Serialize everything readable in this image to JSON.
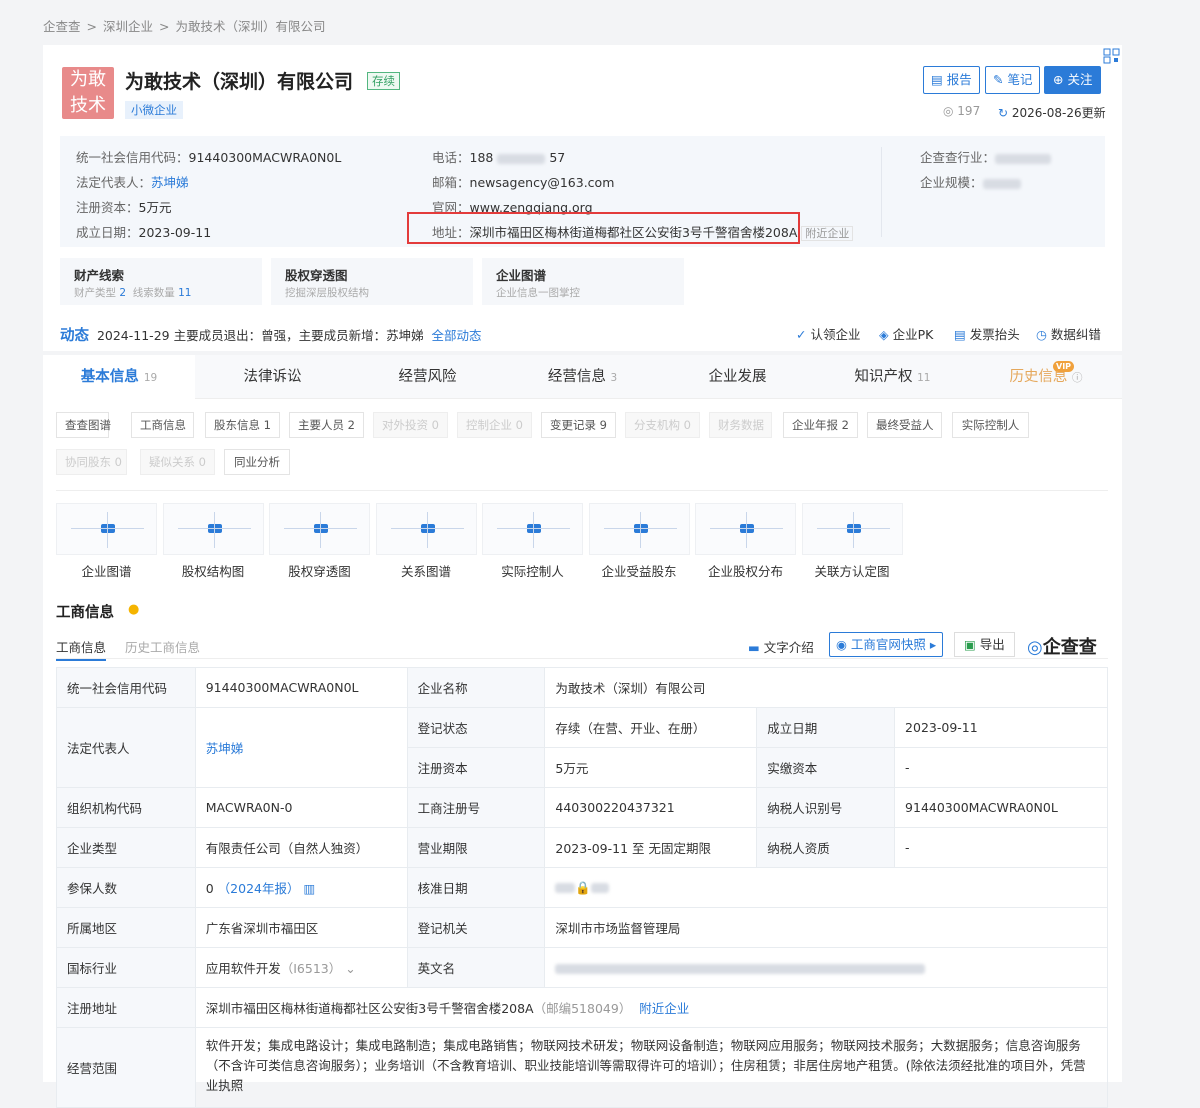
{
  "breadcrumb": {
    "home": "企查查",
    "sep": ">",
    "city": "深圳企业",
    "company": "为敢技术（深圳）有限公司"
  },
  "company": {
    "logo_text": "为敢技术",
    "name": "为敢技术（深圳）有限公司",
    "status": "存续",
    "size_tag": "小微企业"
  },
  "actions": {
    "report": "报告",
    "note": "笔记",
    "follow": "关注",
    "views": "197",
    "updated": "2026-08-26更新"
  },
  "info": {
    "credit_code_label": "统一社会信用代码：",
    "credit_code": "91440300MACWRA0N0L",
    "legal_label": "法定代表人：",
    "legal": "苏坤娣",
    "capital_label": "注册资本：",
    "capital": "5万元",
    "founded_label": "成立日期：",
    "founded": "2023-09-11",
    "phone_label": "电话：",
    "phone_a": "188",
    "phone_b": "57",
    "email_label": "邮箱：",
    "email": "newsagency@163.com",
    "web_label": "官网：",
    "web": "www.zengqiang.org",
    "addr_label": "地址：",
    "addr": "深圳市福田区梅林街道梅都社区公安街3号千警宿舍楼208A",
    "nearby": "附近企业",
    "industry_label": "企查查行业：",
    "scale_label": "企业规模："
  },
  "cards": [
    {
      "title": "财产线索",
      "sub1": "财产类型",
      "n1": "2",
      "sub2": "线索数量",
      "n2": "11"
    },
    {
      "title": "股权穿透图",
      "sub": "挖掘深层股权结构"
    },
    {
      "title": "企业图谱",
      "sub": "企业信息一图掌控"
    }
  ],
  "dynamic": {
    "title": "动态",
    "text": "2024-11-29 主要成员退出：曾强，主要成员新增：苏坤娣",
    "all": "全部动态"
  },
  "tools": [
    "认领企业",
    "企业PK",
    "发票抬头",
    "数据纠错"
  ],
  "tabs": [
    {
      "label": "基本信息",
      "count": "19"
    },
    {
      "label": "法律诉讼",
      "count": ""
    },
    {
      "label": "经营风险",
      "count": ""
    },
    {
      "label": "经营信息",
      "count": "3"
    },
    {
      "label": "企业发展",
      "count": ""
    },
    {
      "label": "知识产权",
      "count": "11"
    },
    {
      "label": "历史信息",
      "count": ""
    }
  ],
  "vip": "VIP",
  "chips": [
    "查查图谱",
    "工商信息",
    "股东信息 1",
    "主要人员 2",
    "对外投资 0",
    "控制企业 0",
    "变更记录 9",
    "分支机构 0",
    "财务数据",
    "企业年报 2",
    "最终受益人",
    "实际控制人",
    "协同股东 0",
    "疑似关系 0",
    "同业分析"
  ],
  "thumbs": [
    "企业图谱",
    "股权结构图",
    "股权穿透图",
    "关系图谱",
    "实际控制人",
    "企业受益股东",
    "企业股权分布",
    "关联方认定图"
  ],
  "section": {
    "title": "工商信息",
    "tab1": "工商信息",
    "tab2": "历史工商信息",
    "text_intro": "文字介绍",
    "snapshot": "工商官网快照",
    "export": "导出",
    "brand": "企查查"
  },
  "table": {
    "credit_code_k": "统一社会信用代码",
    "credit_code_v": "91440300MACWRA0N0L",
    "name_k": "企业名称",
    "name_v": "为敢技术（深圳）有限公司",
    "legal_k": "法定代表人",
    "legal_v": "苏坤娣",
    "reg_status_k": "登记状态",
    "reg_status_v": "存续（在营、开业、在册）",
    "found_k": "成立日期",
    "found_v": "2023-09-11",
    "capital_k": "注册资本",
    "capital_v": "5万元",
    "paid_k": "实缴资本",
    "paid_v": "-",
    "org_k": "组织机构代码",
    "org_v": "MACWRA0N-0",
    "regno_k": "工商注册号",
    "regno_v": "440300220437321",
    "tax_k": "纳税人识别号",
    "tax_v": "91440300MACWRA0N0L",
    "type_k": "企业类型",
    "type_v": "有限责任公司（自然人独资）",
    "term_k": "营业期限",
    "term_v": "2023-09-11 至 无固定期限",
    "taxq_k": "纳税人资质",
    "taxq_v": "-",
    "ins_k": "参保人数",
    "ins_v": "0",
    "ins_note": "（2024年报）",
    "approve_k": "核准日期",
    "region_k": "所属地区",
    "region_v": "广东省深圳市福田区",
    "authority_k": "登记机关",
    "authority_v": "深圳市市场监督管理局",
    "ind_k": "国标行业",
    "ind_v": "应用软件开发",
    "ind_code": "（I6513）",
    "en_k": "英文名",
    "addr_k": "注册地址",
    "addr_v": "深圳市福田区梅林街道梅都社区公安街3号千警宿舍楼208A",
    "zip": "（邮编518049）",
    "nearby": "附近企业",
    "scope_k": "经营范围",
    "scope_v": "软件开发；集成电路设计；集成电路制造；集成电路销售；物联网技术研发；物联网设备制造；物联网应用服务；物联网技术服务；大数据服务；信息咨询服务（不含许可类信息咨询服务）；业务培训（不含教育培训、职业技能培训等需取得许可的培训）；住房租赁；非居住房地产租赁。(除依法须经批准的项目外，凭营业执照"
  }
}
